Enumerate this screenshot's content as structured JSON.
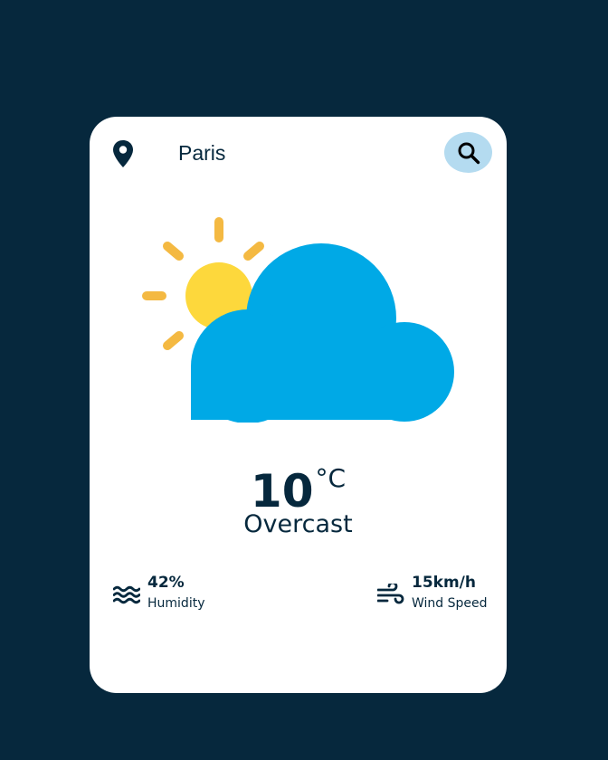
{
  "search": {
    "value": "Paris",
    "icon": "search-icon"
  },
  "location": {
    "icon": "location-pin-icon"
  },
  "weather": {
    "icon": "partly-cloudy-icon",
    "temperature": "10",
    "unit": "°C",
    "description": "Overcast"
  },
  "details": {
    "humidity": {
      "icon": "waves-icon",
      "value": "42%",
      "label": "Humidity"
    },
    "wind": {
      "icon": "wind-icon",
      "value": "15km/h",
      "label": "Wind Speed"
    }
  },
  "colors": {
    "background": "#06283d",
    "card": "#ffffff",
    "text": "#06283d",
    "search_button": "#b4dbf0",
    "cloud": "#00a9e6",
    "sun": "#fdd83c",
    "sun_rays": "#f4b942"
  }
}
